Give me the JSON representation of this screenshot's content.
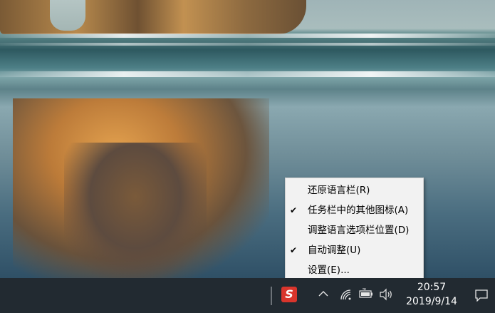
{
  "context_menu": {
    "items": [
      {
        "label": "还原语言栏(R)",
        "checked": false
      },
      {
        "label": "任务栏中的其他图标(A)",
        "checked": true
      },
      {
        "label": "调整语言选项栏位置(D)",
        "checked": false
      },
      {
        "label": "自动调整(U)",
        "checked": true
      },
      {
        "label": "设置(E)...",
        "checked": false
      }
    ],
    "check_glyph": "✔"
  },
  "taskbar": {
    "ime_icon": {
      "name": "sogou-ime-icon",
      "letter": "S",
      "color": "#d9352c"
    },
    "tray_icons": [
      "chevron-up-icon",
      "wifi-icon",
      "battery-icon",
      "speaker-icon"
    ],
    "clock": {
      "time": "20:57",
      "date": "2019/9/14"
    },
    "notification_icon": "action-center-icon",
    "background": "#222a31"
  }
}
